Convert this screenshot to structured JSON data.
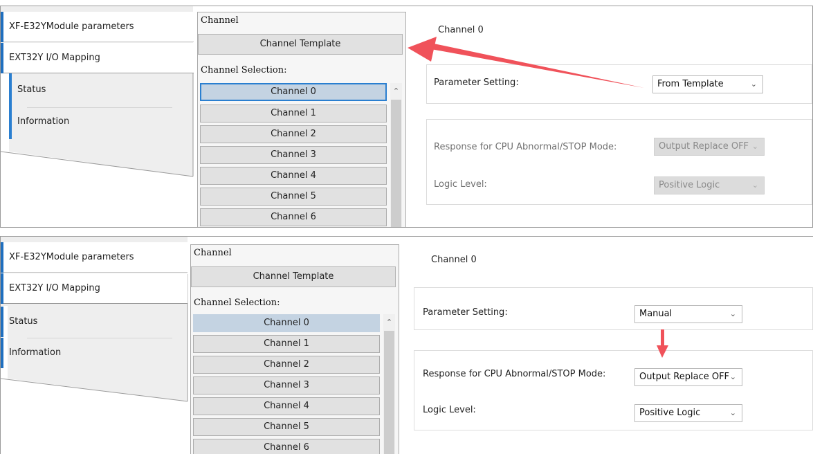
{
  "top": {
    "sidebar": {
      "items": [
        {
          "label": "XF-E32YModule parameters"
        },
        {
          "label": "EXT32Y I/O Mapping"
        },
        {
          "label": "Status"
        },
        {
          "label": "Information"
        }
      ]
    },
    "channel_panel": {
      "title": "Channel",
      "template_button": "Channel Template",
      "selection_label": "Channel Selection:",
      "channels": [
        "Channel 0",
        "Channel 1",
        "Channel 2",
        "Channel 3",
        "Channel 4",
        "Channel 5",
        "Channel 6"
      ],
      "selected": "Channel 0"
    },
    "settings": {
      "channel_label": "Channel 0",
      "parameter_setting_label": "Parameter Setting:",
      "parameter_setting_value": "From Template",
      "response_label": "Response for CPU Abnormal/STOP Mode:",
      "response_value": "Output Replace OFF",
      "response_enabled": false,
      "logic_label": "Logic Level:",
      "logic_value": "Positive Logic",
      "logic_enabled": false
    },
    "annotation_arrow_color": "#f0525a"
  },
  "bottom": {
    "sidebar": {
      "items": [
        {
          "label": "XF-E32YModule parameters"
        },
        {
          "label": "EXT32Y I/O Mapping"
        },
        {
          "label": "Status"
        },
        {
          "label": "Information"
        }
      ]
    },
    "channel_panel": {
      "title": "Channel",
      "template_button": "Channel Template",
      "selection_label": "Channel Selection:",
      "channels": [
        "Channel 0",
        "Channel 1",
        "Channel 2",
        "Channel 3",
        "Channel 4",
        "Channel 5",
        "Channel 6"
      ],
      "selected": "Channel 0"
    },
    "settings": {
      "channel_label": "Channel 0",
      "parameter_setting_label": "Parameter Setting:",
      "parameter_setting_value": "Manual",
      "response_label": "Response for CPU Abnormal/STOP Mode:",
      "response_value": "Output Replace OFF",
      "response_enabled": true,
      "logic_label": "Logic Level:",
      "logic_value": "Positive Logic",
      "logic_enabled": true
    },
    "annotation_arrow_color": "#f0525a"
  },
  "icons": {
    "dropdown": "chevron-down-icon",
    "scroll_up": "chevron-up-icon"
  },
  "colors": {
    "sidebar_accent": "#1f6fbf",
    "selected_channel": "#c4d3e2",
    "focus_border": "#2a7fd0"
  }
}
